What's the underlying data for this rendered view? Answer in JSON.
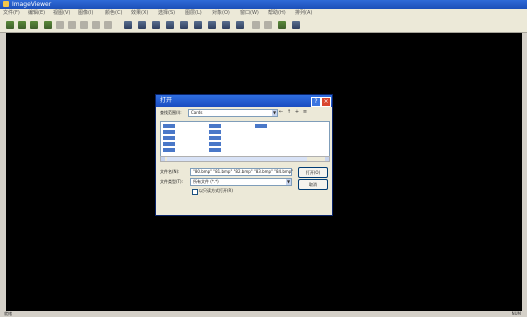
{
  "window": {
    "title": "ImageViewer"
  },
  "menu": [
    "文件(F)",
    "编辑(E)",
    "视图(V)",
    "图像(I)",
    "颜色(C)",
    "效果(X)",
    "选择(S)",
    "图层(L)",
    "对象(O)",
    "窗口(W)",
    "帮助(H)",
    "排列(A)"
  ],
  "dialog": {
    "title": "打开",
    "look_in_label": "查找范围(I):",
    "look_in_value": "Cards",
    "file_name_label": "文件名(N):",
    "file_name_value": "\"80.bmp\" \"81.bmp\" \"82.bmp\" \"83.bmp\" \"84.bmp\"",
    "file_type_label": "文件类型(T):",
    "file_type_value": "所有文件 (*.*)",
    "readonly_label": "以只读方式打开(R)",
    "open_label": "打开(O)",
    "cancel_label": "取消",
    "help_glyph": "?",
    "close_glyph": "×"
  },
  "status": {
    "left": "就绪",
    "right": "NUM"
  }
}
